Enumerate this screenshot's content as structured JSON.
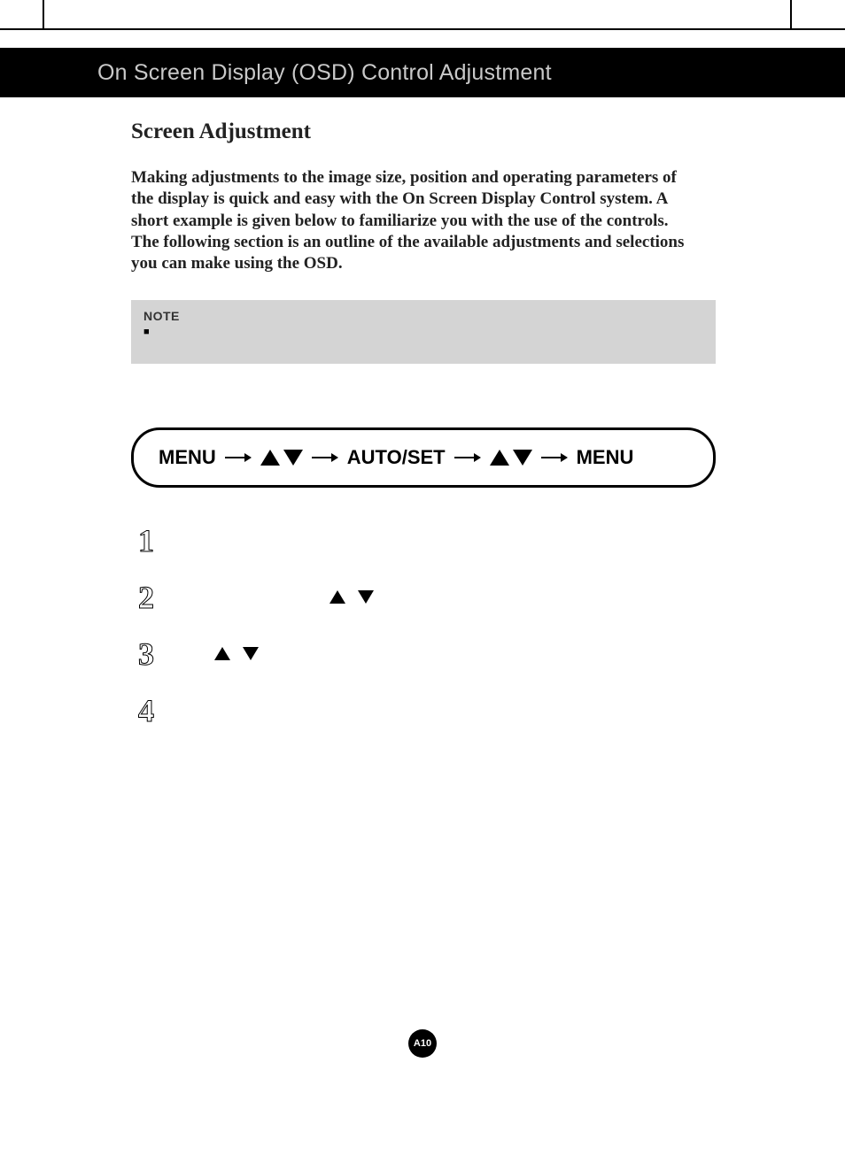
{
  "header": {
    "title": "On Screen Display (OSD) Control Adjustment"
  },
  "section": {
    "heading": "Screen Adjustment",
    "intro": "Making adjustments to the image size, position and operating parameters of the display is quick and easy with the On Screen Display Control system. A short example is given below to familiarize you with the use of the controls. The following section is an outline of the available adjustments and selections you can make using the OSD."
  },
  "note": {
    "label": "NOTE"
  },
  "flow": {
    "item1": "MENU",
    "item2": "AUTO/SET",
    "item3": "MENU"
  },
  "steps": {
    "n1": "1",
    "n2": "2",
    "n3": "3",
    "n4": "4"
  },
  "page": {
    "number": "A10"
  }
}
